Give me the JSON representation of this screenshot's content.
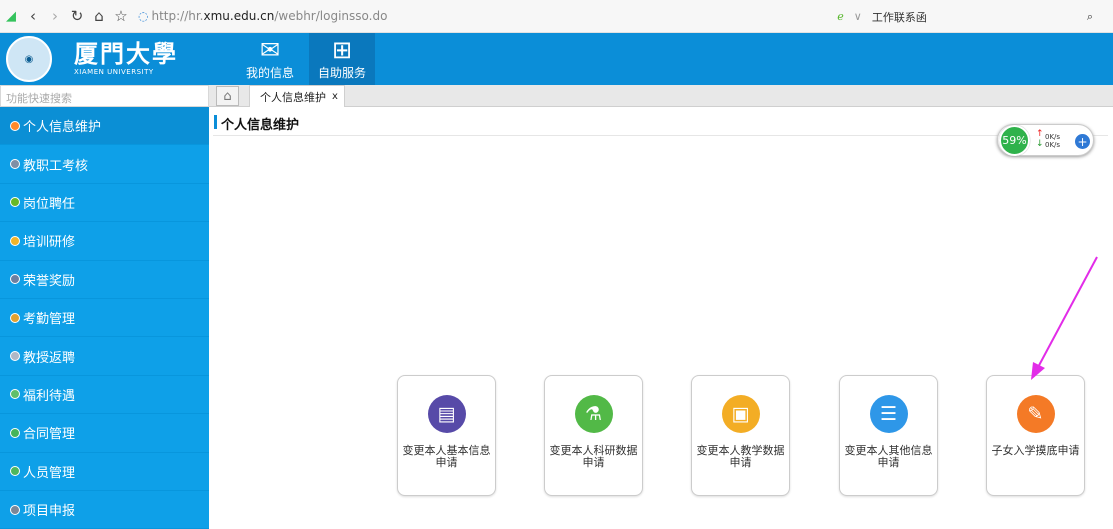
{
  "browser": {
    "url_prefix": "http://hr.",
    "url_domain": "xmu.edu.cn",
    "url_path": "/webhr/loginsso.do",
    "right_label": "工作联系函"
  },
  "header": {
    "logo_cn": "厦門大學",
    "logo_en": "XIAMEN UNIVERSITY",
    "nav": [
      {
        "label": "我的信息"
      },
      {
        "label": "自助服务"
      }
    ]
  },
  "search": {
    "placeholder": "功能快速搜索"
  },
  "tab": {
    "label": "个人信息维护",
    "close": "x"
  },
  "page_title": "个人信息维护",
  "speed_widget": {
    "percent": "59%",
    "up": "0K/s",
    "down": "0K/s"
  },
  "sidebar": {
    "items": [
      {
        "label": "个人信息维护",
        "icon": "person-icon",
        "color": "#ff8a2a"
      },
      {
        "label": "教职工考核",
        "icon": "assessment-icon",
        "color": "#7f8fa6"
      },
      {
        "label": "岗位聘任",
        "icon": "position-icon",
        "color": "#67b827"
      },
      {
        "label": "培训研修",
        "icon": "training-icon",
        "color": "#f0b429"
      },
      {
        "label": "荣誉奖励",
        "icon": "honor-icon",
        "color": "#6e7fa0"
      },
      {
        "label": "考勤管理",
        "icon": "attendance-icon",
        "color": "#e2a12f"
      },
      {
        "label": "教授返聘",
        "icon": "rehire-icon",
        "color": "#b0b8c6"
      },
      {
        "label": "福利待遇",
        "icon": "welfare-icon",
        "color": "#5fbf6a"
      },
      {
        "label": "合同管理",
        "icon": "contract-icon",
        "color": "#45b45a"
      },
      {
        "label": "人员管理",
        "icon": "staff-icon",
        "color": "#4eb75d"
      },
      {
        "label": "项目申报",
        "icon": "project-icon",
        "color": "#7c8798"
      }
    ]
  },
  "cards": [
    {
      "label": "变更本人基本信息申请",
      "icon": "document-icon",
      "color": "#574aa8"
    },
    {
      "label": "变更本人科研数据申请",
      "icon": "microscope-icon",
      "color": "#52b947"
    },
    {
      "label": "变更本人教学数据申请",
      "icon": "teaching-icon",
      "color": "#f3ad25"
    },
    {
      "label": "变更本人其他信息申请",
      "icon": "list-icon",
      "color": "#2e97e8"
    },
    {
      "label": "子女入学摸底申请",
      "icon": "edit-icon",
      "color": "#f47a26"
    }
  ]
}
